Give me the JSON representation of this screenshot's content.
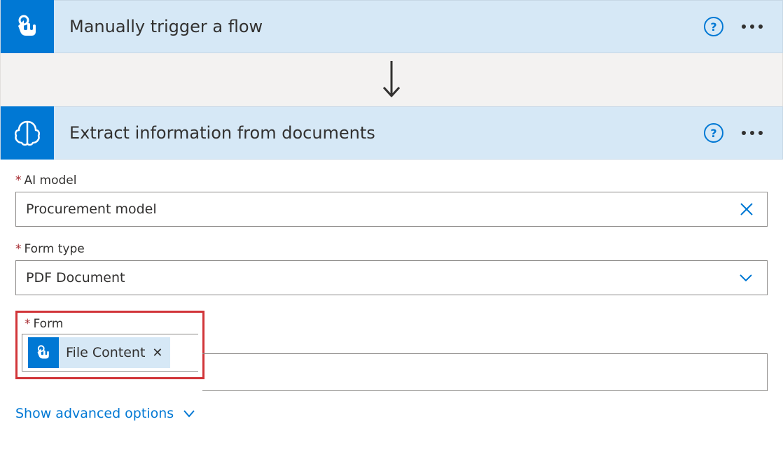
{
  "trigger": {
    "title": "Manually trigger a flow"
  },
  "action": {
    "title": "Extract information from documents"
  },
  "fields": {
    "ai_model": {
      "label": "AI model",
      "value": "Procurement model"
    },
    "form_type": {
      "label": "Form type",
      "value": "PDF Document"
    },
    "form": {
      "label": "Form",
      "token": "File Content"
    }
  },
  "advanced": {
    "toggle": "Show advanced options"
  }
}
